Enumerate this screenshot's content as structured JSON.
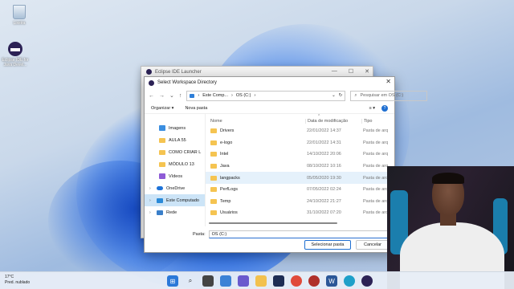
{
  "desktop": {
    "recycle_label": "Lixeira",
    "eclipse_label": "Eclipse IDE for Java Devel..."
  },
  "launcher": {
    "title": "Eclipse IDE Launcher"
  },
  "dialog": {
    "title": "Select Workspace Directory",
    "address": {
      "part1": "Este Comp...",
      "part2": "OS (C:)"
    },
    "search_placeholder": "Pesquisar em OS (C:)",
    "cmd": {
      "organize": "Organizar ▾",
      "new_folder": "Nova pasta"
    },
    "nav": [
      {
        "label": "Imagens",
        "icon": "images-icon"
      },
      {
        "label": "AULA 55",
        "icon": "folder-icon"
      },
      {
        "label": "COMO CRIAR L",
        "icon": "folder-icon"
      },
      {
        "label": "MÓDULO 13",
        "icon": "folder-icon"
      },
      {
        "label": "Vídeos",
        "icon": "videos-icon"
      },
      {
        "label": "OneDrive",
        "icon": "onedrive-icon"
      },
      {
        "label": "Este Computado",
        "icon": "computer-icon"
      },
      {
        "label": "Rede",
        "icon": "network-icon"
      }
    ],
    "columns": {
      "name": "Nome",
      "date": "Data de modificação",
      "type": "Tipo"
    },
    "files": [
      {
        "name": "Drivers",
        "date": "22/01/2022 14:37",
        "type": "Pasta de arq"
      },
      {
        "name": "e-logo",
        "date": "22/01/2022 14:31",
        "type": "Pasta de arq"
      },
      {
        "name": "Intel",
        "date": "14/10/2022 20:06",
        "type": "Pasta de arq"
      },
      {
        "name": "Java",
        "date": "08/10/2022 10:16",
        "type": "Pasta de arq"
      },
      {
        "name": "langpacks",
        "date": "05/05/2020 19:30",
        "type": "Pasta de arq"
      },
      {
        "name": "PerfLogs",
        "date": "07/05/2022 02:24",
        "type": "Pasta de arq"
      },
      {
        "name": "Temp",
        "date": "24/10/2022 21:27",
        "type": "Pasta de arq"
      },
      {
        "name": "Usuários",
        "date": "31/10/2022 07:20",
        "type": "Pasta de arq"
      }
    ],
    "folder_label": "Pasta:",
    "folder_value": "OS (C:)",
    "select_button": "Selecionar pasta",
    "cancel_button": "Cancelar"
  },
  "taskbar": {
    "temperature": "17°C",
    "weather": "Pred. nublado",
    "icons": [
      "windows-icon",
      "search-icon",
      "task-view-icon",
      "widgets-icon",
      "chat-icon",
      "explorer-icon",
      "dell-icon",
      "chrome-icon",
      "app-icon",
      "word-icon",
      "edge-icon",
      "eclipse-icon"
    ]
  }
}
